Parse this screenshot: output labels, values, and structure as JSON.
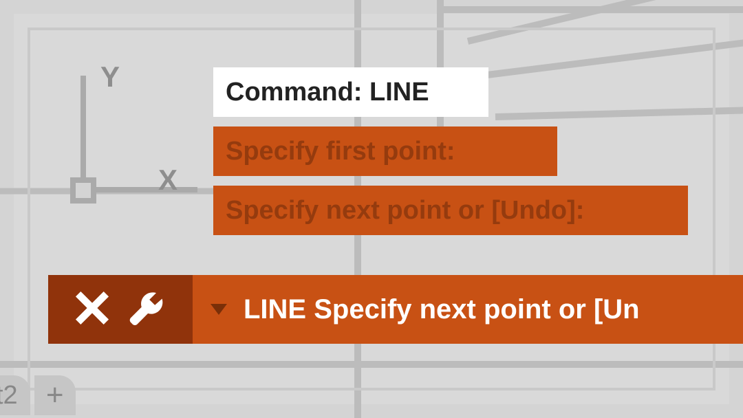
{
  "ucs": {
    "y_label": "Y",
    "x_label": "X"
  },
  "log": {
    "command_line": "Command: LINE",
    "prompt1": "Specify first point:",
    "prompt2": "Specify next point or [Undo]:"
  },
  "command_bar": {
    "active_prompt": "LINE Specify next point or [Un"
  },
  "tabs": {
    "layout2": "t2",
    "add": "+"
  },
  "colors": {
    "orange": "#c85114",
    "dark_orange": "#90330b",
    "bg": "#d4d4d4",
    "axis": "#aaaaaa"
  }
}
